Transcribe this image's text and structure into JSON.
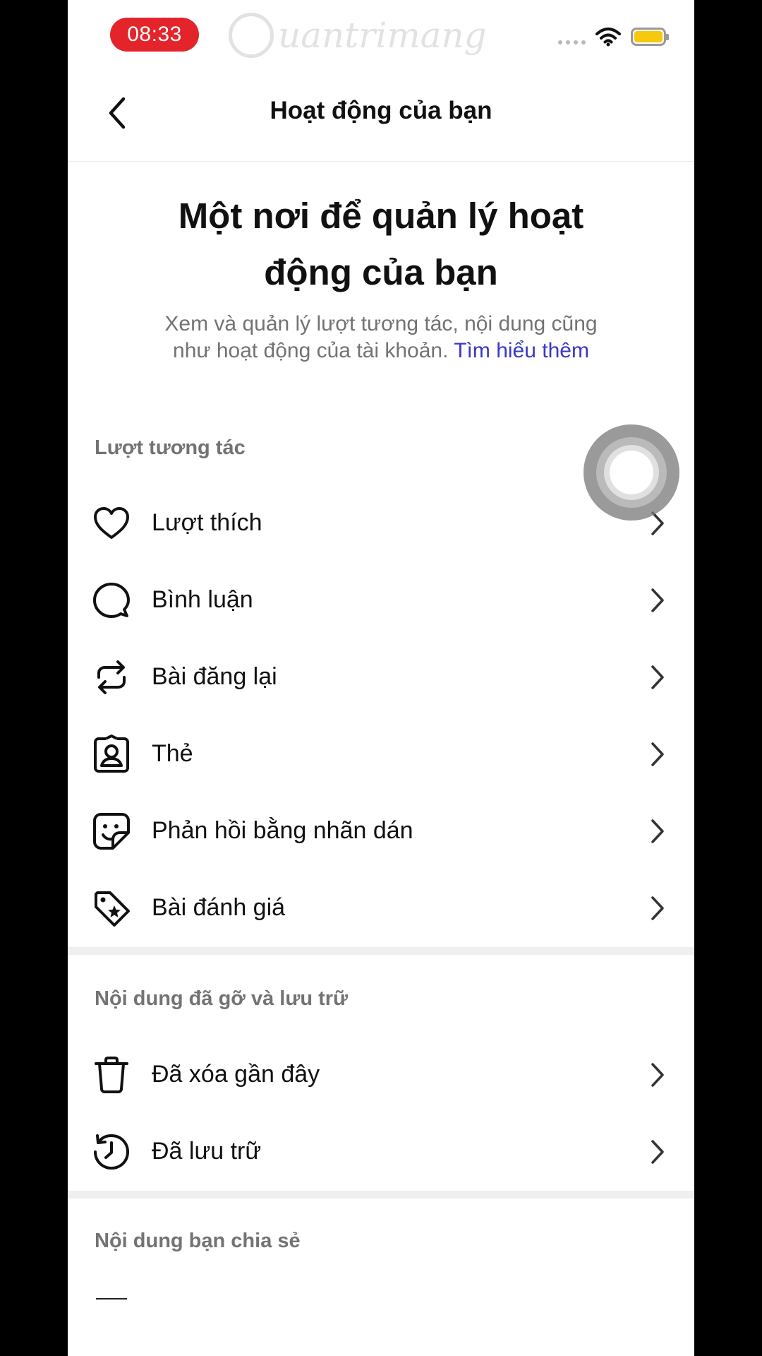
{
  "status_bar": {
    "time": "08:33",
    "watermark": "uantrimang",
    "battery_color": "#f6c90e"
  },
  "header": {
    "title": "Hoạt động của bạn",
    "back_icon": "chevron-left-icon"
  },
  "intro": {
    "title": "Một nơi để quản lý hoạt động của bạn",
    "description": "Xem và quản lý lượt tương tác, nội dung cũng như hoạt động của tài khoản.",
    "link": "Tìm hiểu thêm"
  },
  "sections": [
    {
      "title": "Lượt tương tác",
      "items": [
        {
          "label": "Lượt thích",
          "icon": "heart-icon"
        },
        {
          "label": "Bình luận",
          "icon": "comment-icon"
        },
        {
          "label": "Bài đăng lại",
          "icon": "repost-icon"
        },
        {
          "label": "Thẻ",
          "icon": "tag-person-icon"
        },
        {
          "label": "Phản hồi bằng nhãn dán",
          "icon": "sticker-icon"
        },
        {
          "label": "Bài đánh giá",
          "icon": "review-tag-icon"
        }
      ]
    },
    {
      "title": "Nội dung đã gỡ và lưu trữ",
      "items": [
        {
          "label": "Đã xóa gần đây",
          "icon": "trash-icon"
        },
        {
          "label": "Đã lưu trữ",
          "icon": "archive-history-icon"
        }
      ]
    },
    {
      "title": "Nội dung bạn chia sẻ",
      "items": []
    }
  ],
  "colors": {
    "time_pill": "#e3242b",
    "link": "#3838c6",
    "secondary_text": "#737373"
  }
}
